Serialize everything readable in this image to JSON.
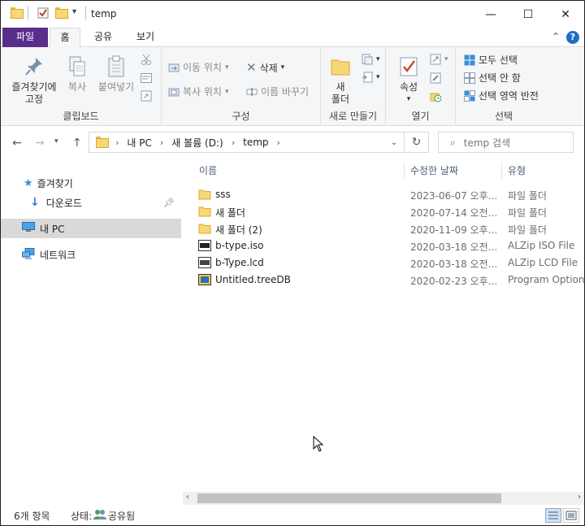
{
  "window": {
    "title": "temp",
    "minimize": "—",
    "maximize": "☐",
    "close": "✕"
  },
  "tabs": [
    {
      "label": "파일"
    },
    {
      "label": "홈"
    },
    {
      "label": "공유"
    },
    {
      "label": "보기"
    }
  ],
  "ribbon": {
    "clipboard": {
      "group_label": "클립보드",
      "pin_label_1": "즐겨찾기에",
      "pin_label_2": "고정",
      "copy_label": "복사",
      "paste_label": "붙여넣기"
    },
    "organize": {
      "group_label": "구성",
      "move_to": "이동 위치",
      "copy_to": "복사 위치",
      "delete": "삭제",
      "rename": "이름 바꾸기"
    },
    "new": {
      "group_label": "새로 만들기",
      "new_folder_1": "새",
      "new_folder_2": "폴더"
    },
    "open": {
      "group_label": "열기",
      "properties": "속성"
    },
    "select": {
      "group_label": "선택",
      "select_all": "모두 선택",
      "select_none": "선택 안 함",
      "invert": "선택 영역 반전"
    }
  },
  "address": {
    "crumbs": [
      "내 PC",
      "새 볼륨 (D:)",
      "temp"
    ],
    "search_placeholder": "temp 검색"
  },
  "nav": {
    "items": [
      {
        "label": "즐겨찾기"
      },
      {
        "label": "다운로드"
      },
      {
        "label": "내 PC"
      },
      {
        "label": "네트워크"
      }
    ]
  },
  "columns": {
    "name": "이름",
    "modified": "수정한 날짜",
    "type": "유형"
  },
  "files": [
    {
      "name": "sss",
      "modified": "2023-06-07 오후...",
      "type": "파일 폴더",
      "icon": "folder-icon"
    },
    {
      "name": "새 폴더",
      "modified": "2020-07-14 오전...",
      "type": "파일 폴더",
      "icon": "folder-icon"
    },
    {
      "name": "새 폴더 (2)",
      "modified": "2020-11-09 오후...",
      "type": "파일 폴더",
      "icon": "folder-icon"
    },
    {
      "name": "b-type.iso",
      "modified": "2020-03-18 오전...",
      "type": "ALZip ISO File",
      "icon": "iso-file-icon"
    },
    {
      "name": "b-Type.lcd",
      "modified": "2020-03-18 오전...",
      "type": "ALZip LCD File",
      "icon": "lcd-file-icon"
    },
    {
      "name": "Untitled.treeDB",
      "modified": "2020-02-23 오후...",
      "type": "Program Options",
      "icon": "treedb-file-icon"
    }
  ],
  "status": {
    "count": "6개 항목",
    "state_label": "상태:",
    "state_value": "공유됨"
  }
}
